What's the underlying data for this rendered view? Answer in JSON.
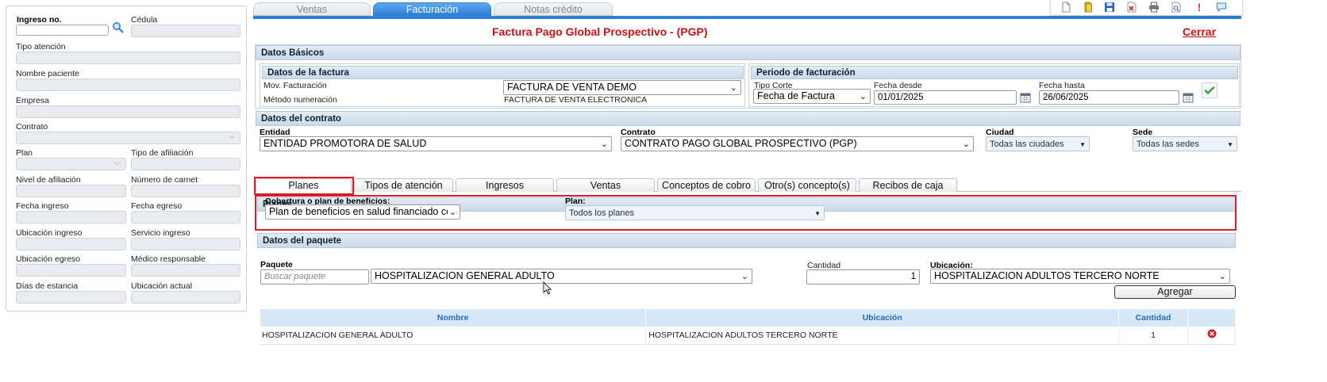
{
  "colors": {
    "accent_blue": "#2f80d8",
    "title_red": "#cc1111",
    "highlight_red": "#d71f28",
    "header_blue": "#2a69b8"
  },
  "left_panel": {
    "ingreso_label": "Ingreso no.",
    "cedula_label": "Cédula",
    "tipo_atencion_label": "Tipo atención",
    "nombre_paciente_label": "Nombre paciente",
    "empresa_label": "Empresa",
    "contrato_label": "Contrato",
    "plan_label": "Plan",
    "tipo_afiliacion_label": "Tipo de afiliación",
    "nivel_afiliacion_label": "Nivel de afiliación",
    "numero_carnet_label": "Número de carnet",
    "fecha_ingreso_label": "Fecha ingreso",
    "fecha_egreso_label": "Fecha egreso",
    "ubicacion_ingreso_label": "Ubicación ingreso",
    "servicio_ingreso_label": "Servicio ingreso",
    "ubicacion_egreso_label": "Ubicación egreso",
    "medico_responsable_label": "Médico responsable",
    "dias_estancia_label": "Días de estancia",
    "ubicacion_actual_label": "Ubicación actual"
  },
  "top_tabs": [
    {
      "label": "Ventas",
      "active": false
    },
    {
      "label": "Facturación",
      "active": true
    },
    {
      "label": "Notas crédito",
      "active": false
    }
  ],
  "toolbar_icons": [
    "new-doc-icon",
    "open-folder-icon",
    "save-icon",
    "excel-icon",
    "print-icon",
    "preview-icon",
    "alert-icon",
    "chat-icon"
  ],
  "page_title": "Factura Pago Global Prospectivo - (PGP)",
  "close_link": "Cerrar",
  "datos_basicos": {
    "title": "Datos Básicos",
    "datos_factura": {
      "title": "Datos de la factura",
      "mov_label": "Mov. Facturación",
      "mov_value": "FACTURA DE VENTA DEMO",
      "metodo_label": "Método numeración",
      "metodo_value": "FACTURA DE VENTA ELECTRONICA"
    },
    "periodo": {
      "title": "Periodo de facturación",
      "tipo_corte_label": "Tipo Corte",
      "tipo_corte_value": "Fecha de Factura",
      "fecha_desde_label": "Fecha desde",
      "fecha_desde_value": "01/01/2025",
      "fecha_hasta_label": "Fecha hasta",
      "fecha_hasta_value": "26/06/2025"
    }
  },
  "contrato": {
    "title": "Datos del contrato",
    "entidad_label": "Entidad",
    "entidad_value": "ENTIDAD PROMOTORA DE SALUD",
    "contrato_label": "Contrato",
    "contrato_value": "CONTRATO PAGO GLOBAL PROSPECTIVO (PGP)",
    "ciudad_label": "Ciudad",
    "ciudad_value": "Todas las ciudades",
    "sede_label": "Sede",
    "sede_value": "Todas las sedes"
  },
  "tabs": [
    {
      "label": "Planes"
    },
    {
      "label": "Tipos de atención"
    },
    {
      "label": "Ingresos"
    },
    {
      "label": "Ventas"
    },
    {
      "label": "Conceptos de cobro"
    },
    {
      "label": "Otro(s) concepto(s)"
    },
    {
      "label": "Recibos de caja"
    }
  ],
  "planes": {
    "title": "Planes",
    "cobertura_label": "Cobertura o plan de beneficios:",
    "cobertura_value": "Plan de beneficios en salud financiado con UPC",
    "plan_label": "Plan:",
    "plan_value": "Todos los planes"
  },
  "paquete": {
    "title": "Datos del paquete",
    "paquete_label": "Paquete",
    "search_placeholder": "Buscar paquete",
    "paquete_value": "HOSPITALIZACION GENERAL ADULTO",
    "cantidad_label": "Cantidad",
    "cantidad_value": "1",
    "ubicacion_label": "Ubicación:",
    "ubicacion_value": "HOSPITALIZACION ADULTOS TERCERO NORTE",
    "agregar_label": "Agregar"
  },
  "table": {
    "headers": {
      "nombre": "Nombre",
      "ubicacion": "Ubicación",
      "cantidad": "Cantidad"
    },
    "rows": [
      {
        "nombre": "HOSPITALIZACION GENERAL ADULTO",
        "ubicacion": "HOSPITALIZACION ADULTOS TERCERO NORTE",
        "cantidad": "1"
      }
    ]
  }
}
